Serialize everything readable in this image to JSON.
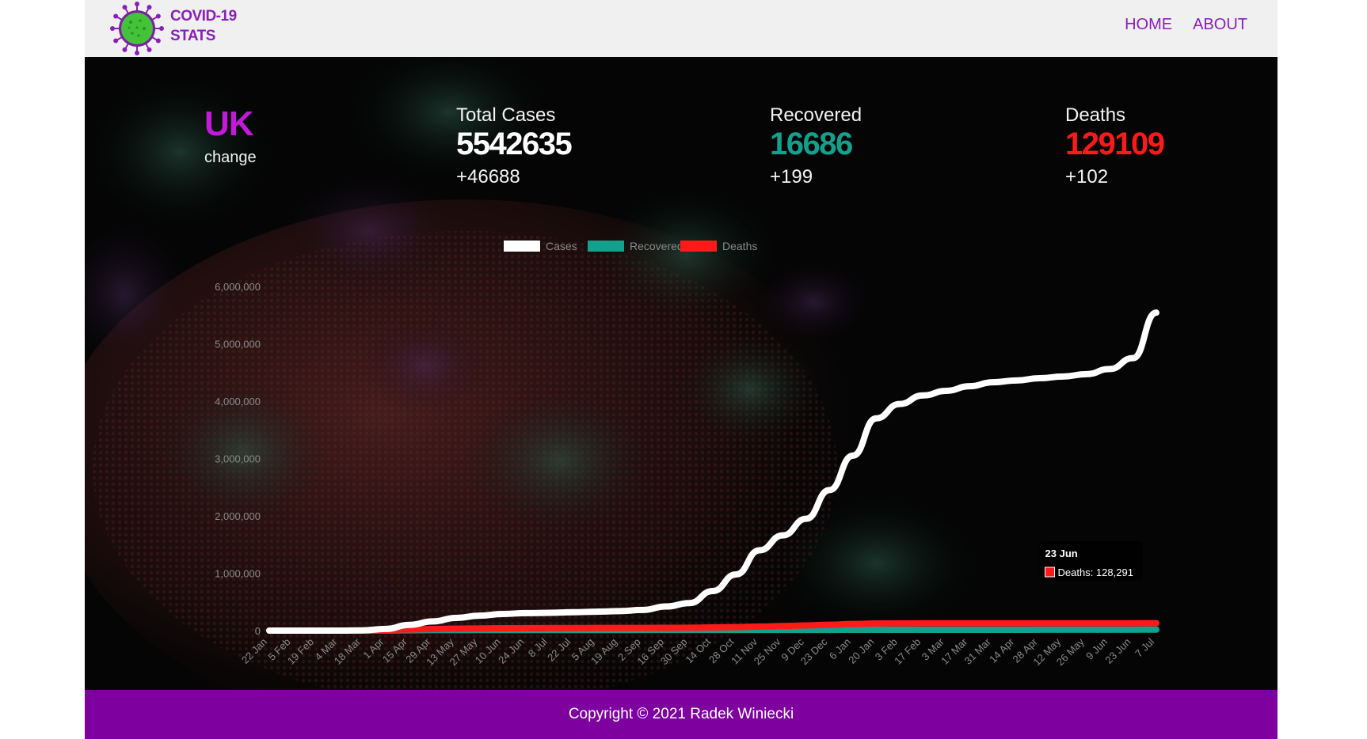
{
  "navbar": {
    "brand_line1": "COVID-19",
    "brand_line2": "STATS",
    "links": [
      {
        "label": "HOME"
      },
      {
        "label": "ABOUT"
      }
    ]
  },
  "summary": {
    "country": "UK",
    "country_sub": "change",
    "cases": {
      "label": "Total Cases",
      "value": "5542635",
      "delta": "+46688"
    },
    "recovered": {
      "label": "Recovered",
      "value": "16686",
      "delta": "+199"
    },
    "deaths": {
      "label": "Deaths",
      "value": "129109",
      "delta": "+102"
    }
  },
  "colors": {
    "brand": "#8a1fb8",
    "country": "#c21ad8",
    "cases": "#ffffff",
    "recovered": "#13a08d",
    "deaths": "#ff1a1a",
    "footer": "#7d009f"
  },
  "chart_data": {
    "type": "line",
    "categories": [
      "22 Jan",
      "5 Feb",
      "19 Feb",
      "4 Mar",
      "18 Mar",
      "1 Apr",
      "15 Apr",
      "29 Apr",
      "13 May",
      "27 May",
      "10 Jun",
      "24 Jun",
      "8 Jul",
      "22 Jul",
      "5 Aug",
      "19 Aug",
      "2 Sep",
      "16 Sep",
      "30 Sep",
      "14 Oct",
      "28 Oct",
      "11 Nov",
      "25 Nov",
      "9 Dec",
      "23 Dec",
      "6 Jan",
      "20 Jan",
      "3 Feb",
      "17 Feb",
      "3 Mar",
      "17 Mar",
      "31 Mar",
      "14 Apr",
      "28 Apr",
      "12 May",
      "26 May",
      "9 Jun",
      "23 Jun",
      "7 Jul"
    ],
    "series": [
      {
        "name": "Cases",
        "color": "#ffffff",
        "values": [
          0,
          0,
          0,
          0,
          4000,
          30000,
          100000,
          160000,
          220000,
          260000,
          290000,
          305000,
          310000,
          320000,
          330000,
          340000,
          360000,
          420000,
          480000,
          690000,
          980000,
          1400000,
          1660000,
          1950000,
          2450000,
          3050000,
          3700000,
          3950000,
          4100000,
          4180000,
          4260000,
          4330000,
          4360000,
          4400000,
          4430000,
          4470000,
          4560000,
          4750000,
          5542635
        ]
      },
      {
        "name": "Recovered",
        "color": "#13a08d",
        "values": [
          0,
          0,
          0,
          0,
          0,
          2000,
          6000,
          8000,
          9000,
          9500,
          10000,
          10300,
          10500,
          10700,
          10900,
          11100,
          11300,
          11500,
          11700,
          11900,
          12100,
          12300,
          12500,
          12700,
          12900,
          13100,
          13300,
          13500,
          13700,
          13900,
          14100,
          14300,
          14500,
          14800,
          15100,
          15400,
          15800,
          16300,
          16686
        ]
      },
      {
        "name": "Deaths",
        "color": "#ff1a1a",
        "values": [
          0,
          0,
          0,
          0,
          2000,
          9000,
          20000,
          28000,
          34000,
          38000,
          41000,
          43000,
          44000,
          45000,
          46000,
          46500,
          47000,
          48000,
          50000,
          55000,
          61000,
          70000,
          80000,
          90000,
          102000,
          115000,
          124000,
          126000,
          127000,
          127500,
          127800,
          128000,
          128100,
          128200,
          128250,
          128280,
          128290,
          128291,
          129109
        ]
      }
    ],
    "ylim": [
      0,
      6000000
    ],
    "yticks": [
      "0",
      "1,000,000",
      "2,000,000",
      "3,000,000",
      "4,000,000",
      "5,000,000",
      "6,000,000"
    ],
    "legend_position": "top",
    "grid": false,
    "tooltip": {
      "title": "23 Jun",
      "label": "Deaths: 128,291"
    }
  },
  "footer": {
    "text": "Copyright © 2021 Radek Winiecki"
  }
}
